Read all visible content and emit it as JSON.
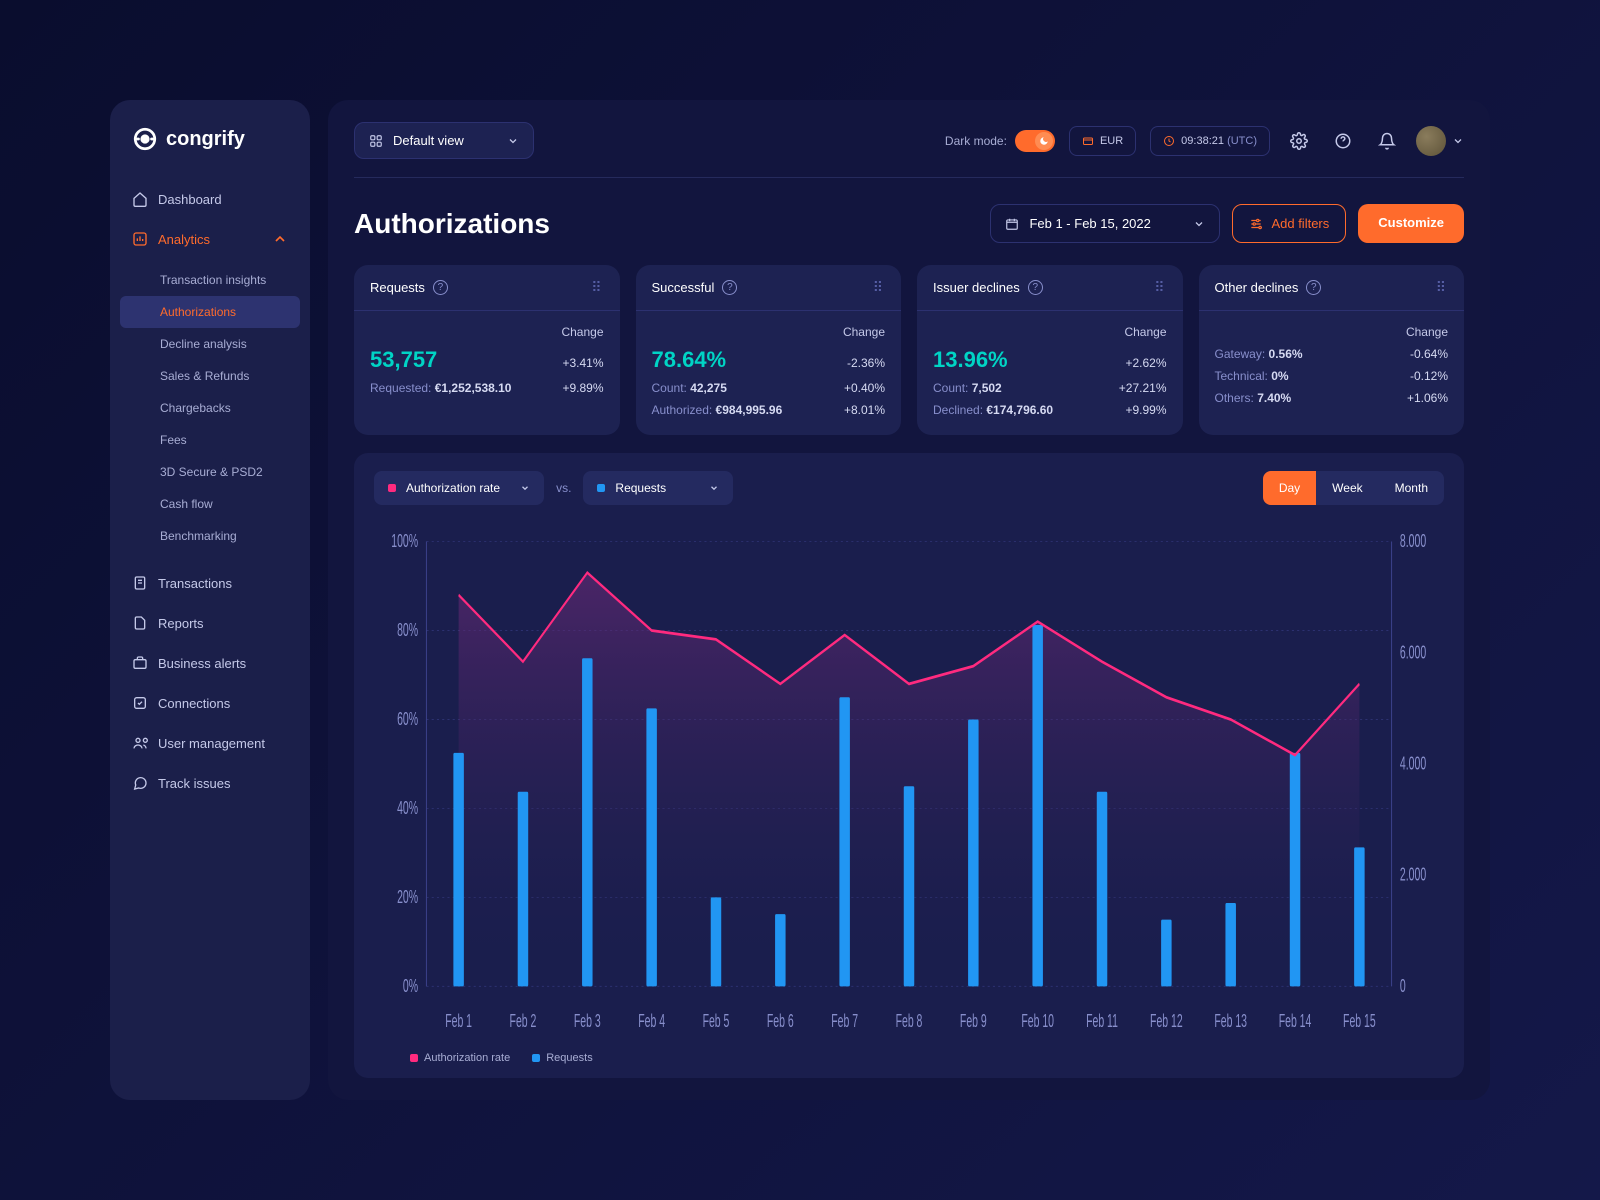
{
  "brand": "congrify",
  "sidebar": {
    "items": [
      {
        "label": "Dashboard"
      },
      {
        "label": "Analytics"
      },
      {
        "label": "Transactions"
      },
      {
        "label": "Reports"
      },
      {
        "label": "Business alerts"
      },
      {
        "label": "Connections"
      },
      {
        "label": "User management"
      },
      {
        "label": "Track issues"
      }
    ],
    "analytics_sub": [
      "Transaction insights",
      "Authorizations",
      "Decline analysis",
      "Sales & Refunds",
      "Chargebacks",
      "Fees",
      "3D Secure & PSD2",
      "Cash flow",
      "Benchmarking"
    ]
  },
  "topbar": {
    "view_label": "Default view",
    "darkmode_label": "Dark mode:",
    "currency": "EUR",
    "time": "09:38:21",
    "tz": "(UTC)"
  },
  "header": {
    "title": "Authorizations",
    "date_range": "Feb 1 - Feb 15, 2022",
    "add_filters": "Add filters",
    "customize": "Customize"
  },
  "cards": [
    {
      "title": "Requests",
      "big": "53,757",
      "big_change": "+3.41%",
      "rows": [
        {
          "label": "Requested:",
          "value": "€1,252,538.10",
          "change": "+9.89%"
        }
      ]
    },
    {
      "title": "Successful",
      "big": "78.64%",
      "big_change": "-2.36%",
      "rows": [
        {
          "label": "Count:",
          "value": "42,275",
          "change": "+0.40%"
        },
        {
          "label": "Authorized:",
          "value": "€984,995.96",
          "change": "+8.01%"
        }
      ]
    },
    {
      "title": "Issuer declines",
      "big": "13.96%",
      "big_change": "+2.62%",
      "rows": [
        {
          "label": "Count:",
          "value": "7,502",
          "change": "+27.21%"
        },
        {
          "label": "Declined:",
          "value": "€174,796.60",
          "change": "+9.99%"
        }
      ]
    },
    {
      "title": "Other declines",
      "big": "",
      "big_change": "",
      "rows": [
        {
          "label": "Gateway:",
          "value": "0.56%",
          "change": "-0.64%"
        },
        {
          "label": "Technical:",
          "value": "0%",
          "change": "-0.12%"
        },
        {
          "label": "Others:",
          "value": "7.40%",
          "change": "+1.06%"
        }
      ]
    }
  ],
  "chart": {
    "metric_a": "Authorization rate",
    "metric_b": "Requests",
    "vs": "vs.",
    "granularity": [
      "Day",
      "Week",
      "Month"
    ],
    "granularity_active": 0,
    "legend": [
      "Authorization rate",
      "Requests"
    ],
    "change_label": "Change"
  },
  "chart_data": {
    "type": "bar+line",
    "categories": [
      "Feb 1",
      "Feb 2",
      "Feb 3",
      "Feb 4",
      "Feb 5",
      "Feb 6",
      "Feb 7",
      "Feb 8",
      "Feb 9",
      "Feb 10",
      "Feb 11",
      "Feb 12",
      "Feb 13",
      "Feb 14",
      "Feb 15"
    ],
    "series": [
      {
        "name": "Authorization rate",
        "axis": "left",
        "type": "line",
        "values": [
          88,
          73,
          93,
          80,
          78,
          68,
          79,
          68,
          72,
          82,
          73,
          65,
          60,
          52,
          68
        ]
      },
      {
        "name": "Requests",
        "axis": "right",
        "type": "bar",
        "values": [
          4200,
          3500,
          5900,
          5000,
          1600,
          1300,
          5200,
          3600,
          4800,
          6500,
          3500,
          1200,
          1500,
          4200,
          2500
        ]
      }
    ],
    "y_left": {
      "label": "%",
      "ticks": [
        0,
        20,
        40,
        60,
        80,
        100
      ]
    },
    "y_right": {
      "label": "",
      "ticks": [
        0,
        2000,
        4000,
        6000,
        8000
      ]
    },
    "colors": {
      "line": "#ff2a7f",
      "bar": "#2196f3",
      "area_top": "#6b2a78",
      "area_bottom": "#1a1e4d"
    }
  }
}
